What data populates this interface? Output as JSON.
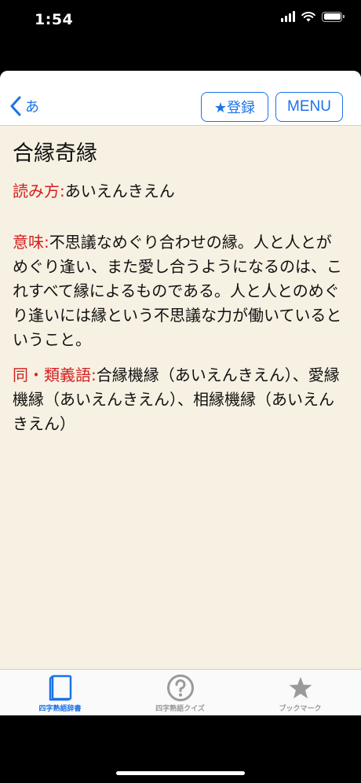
{
  "status_bar": {
    "time": "1:54"
  },
  "nav": {
    "back_label": "あ",
    "register_label": "★登録",
    "menu_label": "MENU"
  },
  "entry": {
    "title": "合縁奇縁",
    "reading_label": "読み方:",
    "reading": "あいえんきえん",
    "meaning_label": "意味:",
    "meaning": "不思議なめぐり合わせの縁。人と人とがめぐり逢い、また愛し合うようになるのは、これすべて縁によるものである。人と人とのめぐり逢いには縁という不思議な力が働いているということ。",
    "synonym_label": "同・類義語:",
    "synonym": "合縁機縁（あいえんきえん）、愛縁機縁（あいえんきえん）、相縁機縁（あいえんきえん）"
  },
  "tabs": [
    {
      "label": "四字熟語辞書",
      "icon": "book-icon",
      "active": true
    },
    {
      "label": "四字熟語クイズ",
      "icon": "question-icon",
      "active": false
    },
    {
      "label": "ブックマーク",
      "icon": "star-icon",
      "active": false
    }
  ],
  "colors": {
    "accent": "#1a73e8",
    "label_red": "#d42020",
    "content_bg": "#f7f1e3"
  }
}
